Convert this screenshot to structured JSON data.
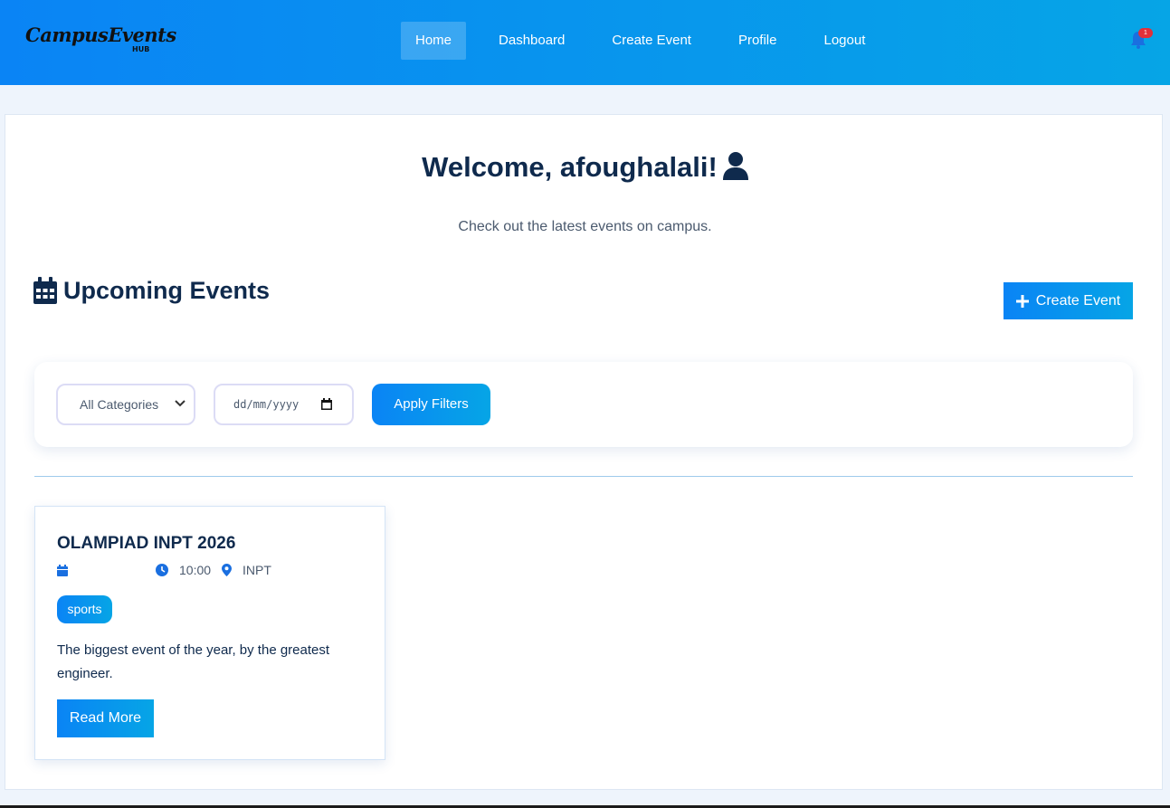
{
  "brand": {
    "logo_text": "CampusEvents",
    "logo_sub": "HUB"
  },
  "nav": {
    "items": [
      {
        "label": "Home",
        "active": true
      },
      {
        "label": "Dashboard",
        "active": false
      },
      {
        "label": "Create Event",
        "active": false
      },
      {
        "label": "Profile",
        "active": false
      },
      {
        "label": "Logout",
        "active": false
      }
    ],
    "notification_icon": "bell-icon",
    "notification_count": "1"
  },
  "welcome": {
    "heading": "Welcome, afoughalali!",
    "icon": "user-icon",
    "subtitle": "Check out the latest events on campus."
  },
  "events_section": {
    "title": "Upcoming Events",
    "title_icon": "calendar-icon",
    "create_button": "Create Event"
  },
  "filters": {
    "category_selected": "All Categories",
    "date_placeholder": "dd/mm/yyyy",
    "apply_button": "Apply Filters"
  },
  "events": [
    {
      "title": "OLAMPIAD INPT 2026",
      "date": "",
      "time": "10:00",
      "location": "INPT",
      "category": "sports",
      "description": "The biggest event of the year, by the greatest engineer.",
      "read_more": "Read More"
    }
  ],
  "colors": {
    "accent_start": "#0a84f5",
    "accent_end": "#06a5e6",
    "heading": "#0f2a4d",
    "badge": "#e2303a"
  }
}
